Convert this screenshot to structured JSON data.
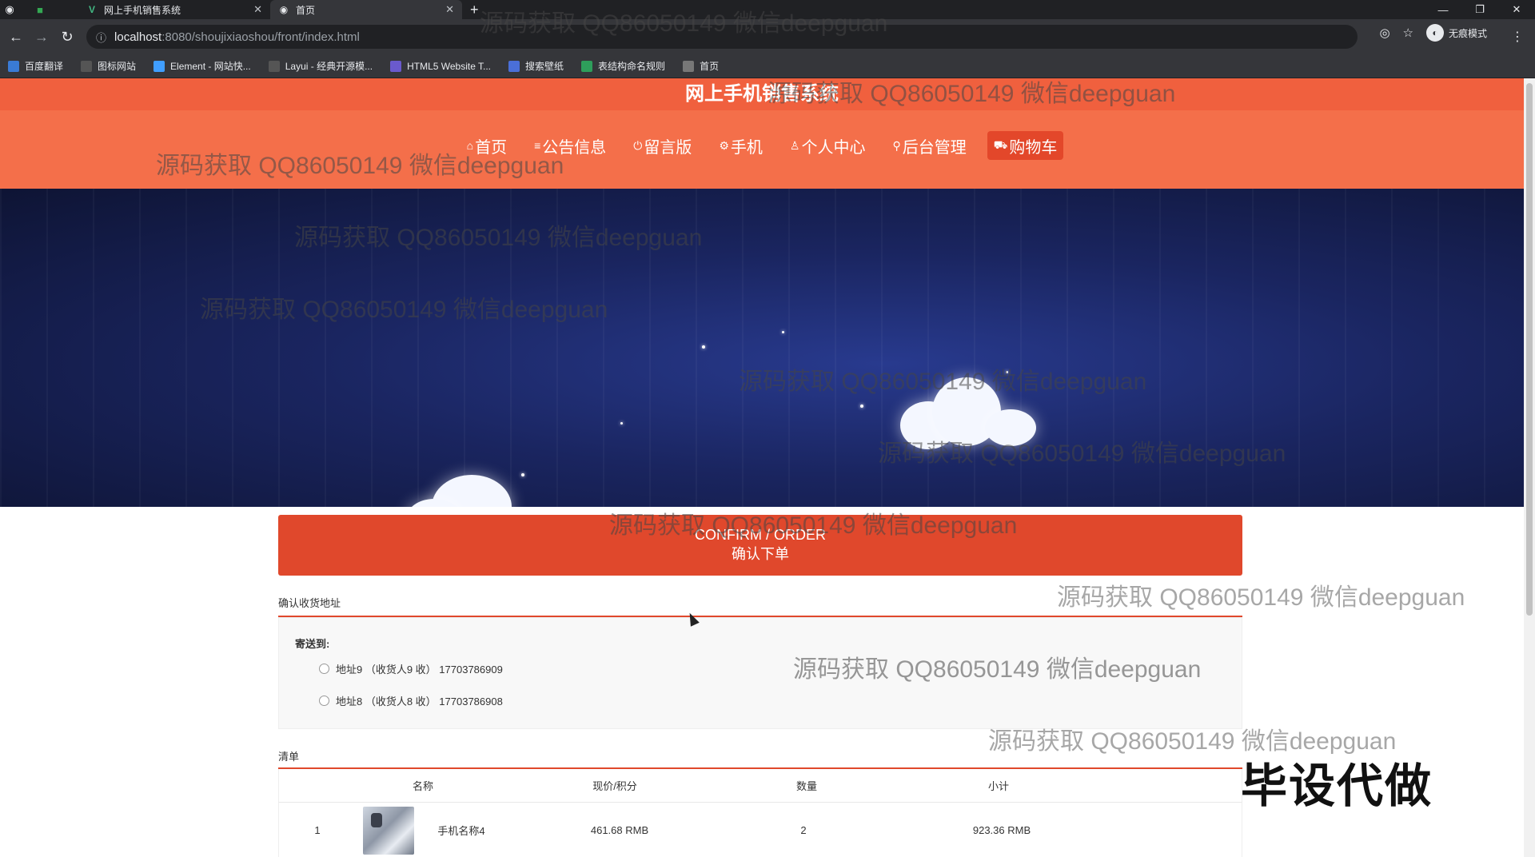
{
  "browser": {
    "tabs": [
      {
        "title": "网上手机销售系统"
      },
      {
        "title": "首页"
      }
    ],
    "url_host": "localhost",
    "url_path": ":8080/shoujixiaoshou/front/index.html",
    "incognito_label": "无痕模式",
    "bookmarks": [
      {
        "label": "百度翻译",
        "color": "#3a7bd5"
      },
      {
        "label": "图标网站",
        "color": "#555555"
      },
      {
        "label": "Element - 网站快...",
        "color": "#409eff"
      },
      {
        "label": "Layui - 经典开源模...",
        "color": "#555555"
      },
      {
        "label": "HTML5 Website T...",
        "color": "#6a5acd"
      },
      {
        "label": "搜索壁纸",
        "color": "#4a6fd8"
      },
      {
        "label": "表结构命名规则",
        "color": "#2e9e5b"
      },
      {
        "label": "首页",
        "color": "#777777"
      }
    ]
  },
  "site": {
    "title": "网上手机销售系统",
    "nav": [
      {
        "label": "首页",
        "icon": "home-icon"
      },
      {
        "label": "公告信息",
        "icon": "list-icon"
      },
      {
        "label": "留言版",
        "icon": "power-icon"
      },
      {
        "label": "手机",
        "icon": "gear-icon"
      },
      {
        "label": "个人中心",
        "icon": "user-icon"
      },
      {
        "label": "后台管理",
        "icon": "link-icon"
      },
      {
        "label": "购物车",
        "icon": "cart-icon",
        "active": true
      }
    ],
    "accent_color": "#f46f4a"
  },
  "order": {
    "banner_en": "CONFIRM / ORDER",
    "banner_zh": "确认下单",
    "address_section_title": "确认收货地址",
    "send_to_label": "寄送到:",
    "addresses": [
      {
        "text": "地址9 （收货人9 收） 17703786909"
      },
      {
        "text": "地址8 （收货人8 收） 17703786908"
      }
    ],
    "list_section_title": "清单",
    "columns": [
      "名称",
      "现价/积分",
      "数量",
      "小计"
    ],
    "items": [
      {
        "index": "1",
        "name": "手机名称4",
        "price": "461.68 RMB",
        "qty": "2",
        "subtotal": "923.36 RMB"
      }
    ]
  },
  "watermarks": {
    "text": "源码获取 QQ86050149 微信deepguan",
    "big": "毕设代做"
  }
}
